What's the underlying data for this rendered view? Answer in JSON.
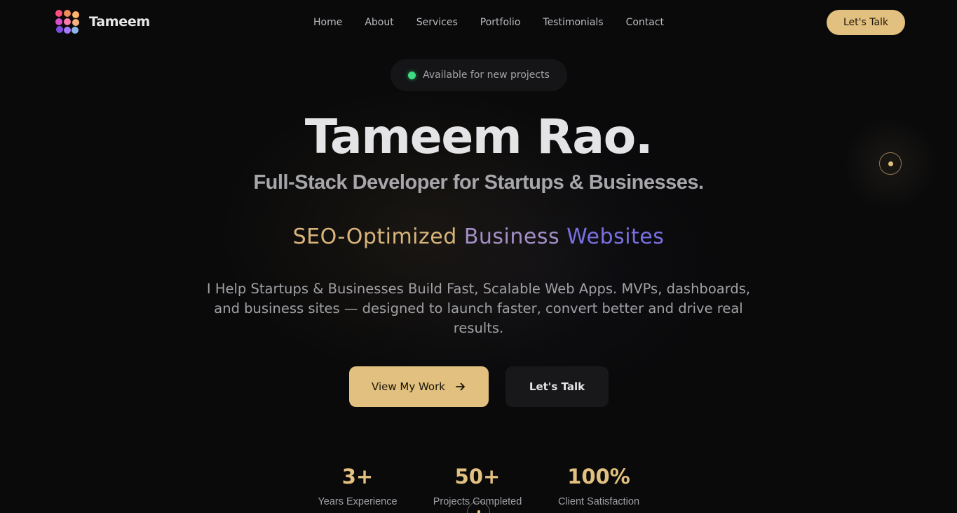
{
  "brand": {
    "name": "Tameem",
    "logo_icon": "dots-grid-logo",
    "logo_colors": [
      "#ff4f7d",
      "#f08b5a",
      "#ffb36b",
      "#d94fc7",
      "#ff7aa8",
      "#f5b27e",
      "#7e4ce0",
      "#a779ff",
      "#8fb4e8"
    ]
  },
  "nav": {
    "items": [
      {
        "label": "Home"
      },
      {
        "label": "About"
      },
      {
        "label": "Services"
      },
      {
        "label": "Portfolio"
      },
      {
        "label": "Testimonials"
      },
      {
        "label": "Contact"
      }
    ],
    "cta_label": "Let's Talk"
  },
  "availability": {
    "text": "Available for new projects",
    "status_color": "#3ddc84"
  },
  "hero": {
    "name": "Tameem Rao.",
    "subtitle": "Full-Stack Developer for Startups & Businesses.",
    "tagline_parts": [
      "SEO-Optimized",
      "Business",
      "Websites"
    ],
    "description": "I Help Startups & Businesses Build Fast, Scalable Web Apps. MVPs, dashboards, and business sites — designed to launch faster, convert better and drive real results.",
    "primary_button": "View My Work",
    "primary_button_icon": "arrow-right-icon",
    "secondary_button": "Let's Talk"
  },
  "stats": [
    {
      "value": "3+",
      "label": "Years Experience"
    },
    {
      "value": "50+",
      "label": "Projects Completed"
    },
    {
      "value": "100%",
      "label": "Client Satisfaction"
    }
  ],
  "colors": {
    "accent": "#e2c07f",
    "background": "#0a0a0b",
    "button_dark": "#18181b",
    "gradient_start": "#d9b57a",
    "gradient_end": "#7a6fe0"
  }
}
